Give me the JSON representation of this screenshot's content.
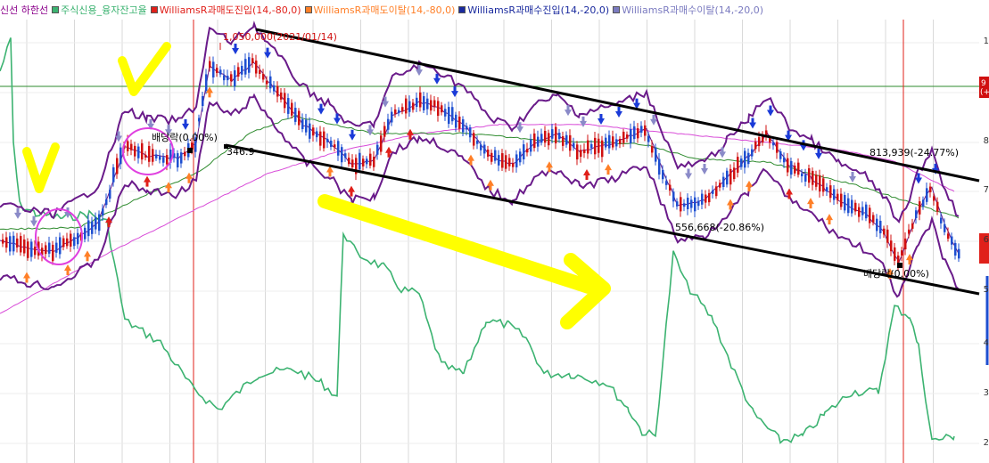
{
  "chart_data": {
    "type": "line",
    "legend": [
      {
        "label": "신선 하한선",
        "color": "#8b008b"
      },
      {
        "label": "주식신용_융자잔고율",
        "color": "#3cb371"
      },
      {
        "label": "WilliamsR과매도진입(14,-80,0)",
        "color": "#e0201a"
      },
      {
        "label": "WilliamsR과매도이탈(14,-80,0)",
        "color": "#ff7f27"
      },
      {
        "label": "WilliamsR과매수진입(14,-20,0)",
        "color": "#1a2a9e"
      },
      {
        "label": "WilliamsR과매수이탈(14,-20,0)",
        "color": "#7b7bc0"
      }
    ],
    "annotations": [
      {
        "label": "1,050,000(2021/01/14)",
        "color": "#d01010"
      },
      {
        "label": "배당락(0.00%)",
        "color": "#000000"
      },
      {
        "label": "813,939(-24.77%)",
        "color": "#000000"
      },
      {
        "label": "556,668(-20.86%)",
        "color": "#000000"
      },
      {
        "label": "배당락(0.00%)",
        "color": "#000000"
      },
      {
        "label": "346.9",
        "color": "#000000"
      }
    ],
    "right_axis_ticks": [
      "1",
      "9",
      "8",
      "7",
      "6",
      "5",
      "4",
      "3",
      "2"
    ],
    "right_axis_marker": "9\n(+",
    "colors": {
      "price_up": "#d01010",
      "price_down": "#1e4fd0",
      "bollinger": "#6a1b8a",
      "ma_long": "#d84bd8",
      "ma_mid": "#2e8b2e",
      "credit_ratio": "#3cb371",
      "trendline": "#000000",
      "highlight": "#ffff00",
      "circle": "#e040e0",
      "vline": "#e0201a",
      "hline": "#2e8b2e"
    }
  }
}
